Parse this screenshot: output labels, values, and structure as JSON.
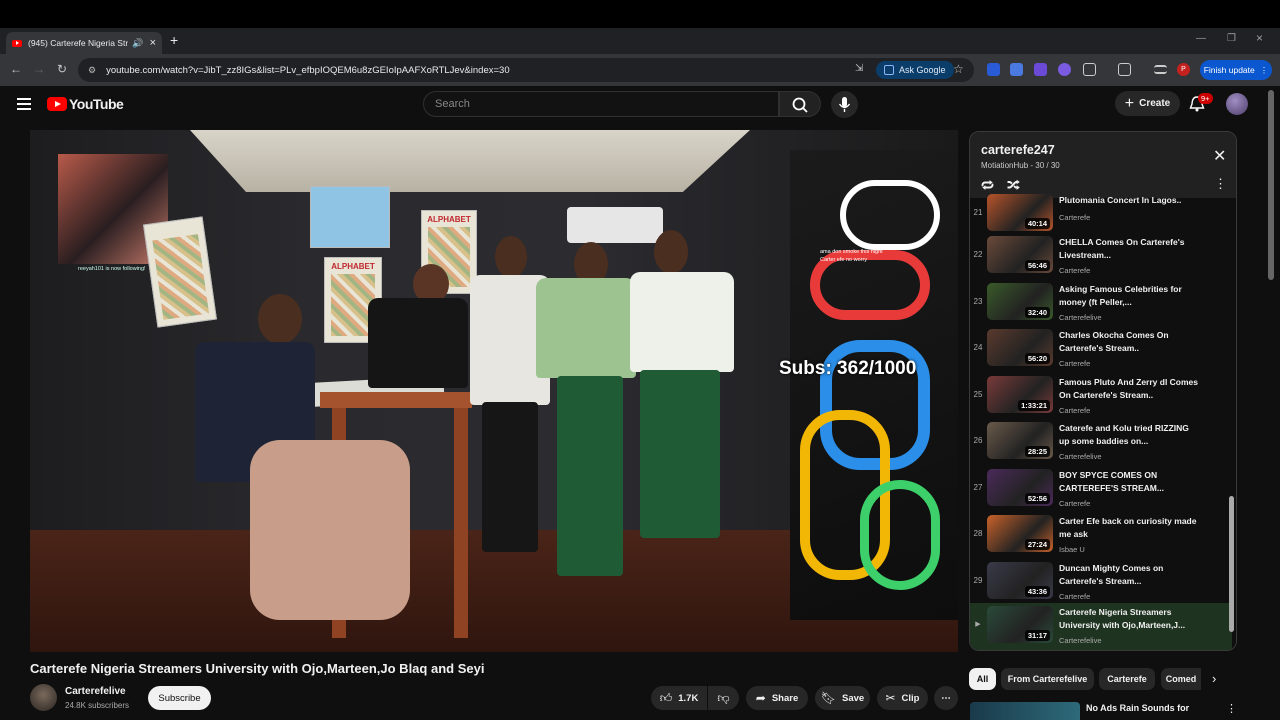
{
  "browser": {
    "tab_title": "(945) Carterefe Nigeria Stre",
    "url": "youtube.com/watch?v=JibT_zz8IGs&list=PLv_efbpIOQEM6u8zGEIoIpAAFXoRTLJev&index=30",
    "ask_google": "Ask Google",
    "finish_update": "Finish update",
    "profile_initial": "P"
  },
  "yt": {
    "logo": "YouTube",
    "search_placeholder": "Search",
    "create": "Create",
    "notifications": "9+"
  },
  "video": {
    "subs_overlay": "Subs: 362/1000",
    "follow_text": "reeyah101 is now following!",
    "chat_lines": [
      "ama don smoke this night",
      "Carter efe no worry"
    ],
    "poster_alphabet": "ALPHABET"
  },
  "watch": {
    "title": "Carterefe Nigeria Streamers University with Ojo,Marteen,Jo Blaq and Seyi",
    "channel": "Carterefelive",
    "subscribers": "24.8K subscribers",
    "subscribe": "Subscribe",
    "likes": "1.7K",
    "share": "Share",
    "save": "Save",
    "clip": "Clip"
  },
  "playlist": {
    "title": "carterefe247",
    "subtitle": "MotiationHub - 30 / 30",
    "items": [
      {
        "index": "21",
        "title": "Plutomania Concert In Lagos..",
        "channel": "Carterefe",
        "duration": "40:14",
        "color": "#b8542a"
      },
      {
        "index": "22",
        "title": "CHELLA Comes On Carterefe's Livestream...",
        "channel": "Carterefe",
        "duration": "56:46",
        "color": "#6a4a3a"
      },
      {
        "index": "23",
        "title": "Asking Famous Celebrities for money (ft Peller,...",
        "channel": "Carterefelive",
        "duration": "32:40",
        "color": "#3a5a2a"
      },
      {
        "index": "24",
        "title": "Charles Okocha Comes On Carterefe's Stream..",
        "channel": "Carterefe",
        "duration": "56:20",
        "color": "#5a3a2e"
      },
      {
        "index": "25",
        "title": "Famous Pluto And Zerry dl Comes On Carterefe's Stream..",
        "channel": "Carterefe",
        "duration": "1:33:21",
        "color": "#7a3a3a"
      },
      {
        "index": "26",
        "title": "Caterefe and Kolu tried RIZZING up some baddies on...",
        "channel": "Carterefelive",
        "duration": "28:25",
        "color": "#6a5a4a"
      },
      {
        "index": "27",
        "title": "BOY SPYCE COMES ON CARTEREFE'S STREAM...",
        "channel": "Carterefe",
        "duration": "52:56",
        "color": "#4a2a5a"
      },
      {
        "index": "28",
        "title": "Carter Efe back on curiosity made me ask",
        "channel": "Isbae U",
        "duration": "27:24",
        "color": "#c8622a"
      },
      {
        "index": "29",
        "title": "Duncan Mighty Comes on Carterefe's Stream...",
        "channel": "Carterefe",
        "duration": "43:36",
        "color": "#3a3a4a"
      },
      {
        "index": "",
        "title": "Carterefe Nigeria Streamers University with Ojo,Marteen,J...",
        "channel": "Carterefelive",
        "duration": "31:17",
        "color": "#2a4a3a"
      }
    ]
  },
  "chips": [
    "All",
    "From Carterefelive",
    "Carterefe",
    "Comed"
  ],
  "next_video": "No Ads Rain Sounds for"
}
